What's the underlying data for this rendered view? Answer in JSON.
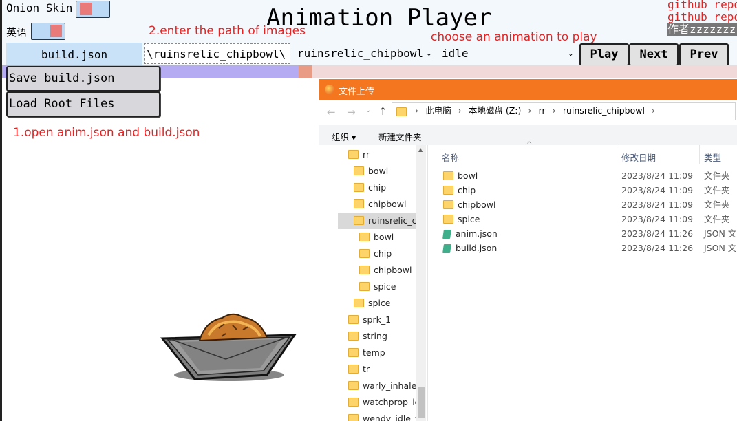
{
  "app": {
    "title": "Animation Player"
  },
  "options": {
    "onion_skin_label": "Onion Skin",
    "language_label": "英语"
  },
  "github": {
    "line1": "github repo",
    "line2": "github repo",
    "author": "作者zzzzzzz"
  },
  "annotations": {
    "step2": "2.enter the path of images",
    "choose": "choose an animation to play",
    "step1": "1.open anim.json and build.json"
  },
  "toolbar": {
    "build_label": "build.json",
    "path_value": "\\ruinsrelic_chipbowl\\",
    "anim_select": "ruinsrelic_chipbowl",
    "state_select": "idle",
    "play": "Play",
    "next": "Next",
    "prev": "Prev"
  },
  "buttons": {
    "save_build": "Save build.json",
    "load_root": "Load Root Files"
  },
  "dialog": {
    "title": "文件上传",
    "breadcrumb": [
      "此电脑",
      "本地磁盘 (Z:)",
      "rr",
      "ruinsrelic_chipbowl"
    ],
    "organize": "组织 ▾",
    "new_folder": "新建文件夹",
    "columns": {
      "name": "名称",
      "date": "修改日期",
      "type": "类型"
    },
    "tree": [
      {
        "label": "rr",
        "indent": 0
      },
      {
        "label": "bowl",
        "indent": 1
      },
      {
        "label": "chip",
        "indent": 1
      },
      {
        "label": "chipbowl",
        "indent": 1
      },
      {
        "label": "ruinsrelic_ch",
        "indent": 1,
        "selected": true
      },
      {
        "label": "bowl",
        "indent": 2
      },
      {
        "label": "chip",
        "indent": 2
      },
      {
        "label": "chipbowl",
        "indent": 2
      },
      {
        "label": "spice",
        "indent": 2
      },
      {
        "label": "spice",
        "indent": 1
      },
      {
        "label": "sprk_1",
        "indent": 0
      },
      {
        "label": "string",
        "indent": 0
      },
      {
        "label": "temp",
        "indent": 0
      },
      {
        "label": "tr",
        "indent": 0
      },
      {
        "label": "warly_inhale_f",
        "indent": 0
      },
      {
        "label": "watchprop_id",
        "indent": 0
      },
      {
        "label": "wendy_idle_flo",
        "indent": 0
      }
    ],
    "files": [
      {
        "name": "bowl",
        "date": "2023/8/24 11:09",
        "type": "文件夹",
        "kind": "folder"
      },
      {
        "name": "chip",
        "date": "2023/8/24 11:09",
        "type": "文件夹",
        "kind": "folder"
      },
      {
        "name": "chipbowl",
        "date": "2023/8/24 11:09",
        "type": "文件夹",
        "kind": "folder"
      },
      {
        "name": "spice",
        "date": "2023/8/24 11:09",
        "type": "文件夹",
        "kind": "folder"
      },
      {
        "name": "anim.json",
        "date": "2023/8/24 11:26",
        "type": "JSON 文",
        "kind": "json"
      },
      {
        "name": "build.json",
        "date": "2023/8/24 11:26",
        "type": "JSON 文",
        "kind": "json"
      }
    ]
  }
}
